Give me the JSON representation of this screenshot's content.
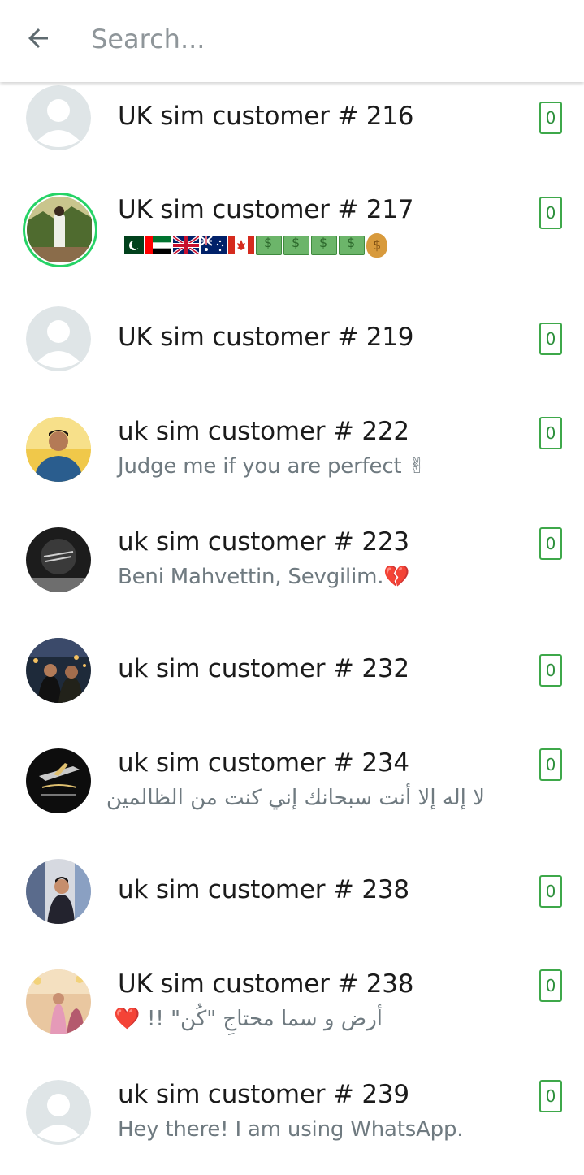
{
  "search": {
    "placeholder": "Search..."
  },
  "contacts": [
    {
      "name": "UK sim customer # 216",
      "about": "",
      "badge": "0",
      "avatar": "default"
    },
    {
      "name": "UK sim customer # 217",
      "about": "",
      "badge": "0",
      "avatar": "photo-outdoor",
      "about_icons": [
        "pakistan-flag-icon",
        "uae-flag-icon",
        "uk-flag-icon",
        "australia-flag-icon",
        "canada-flag-icon",
        "money-wings-icon",
        "dollar-bill-icon",
        "money-wings-icon",
        "money-wings-icon",
        "money-bag-icon"
      ]
    },
    {
      "name": "UK sim customer # 219",
      "about": "",
      "badge": "0",
      "avatar": "default"
    },
    {
      "name": "uk sim customer # 222",
      "about": "Judge me if you are perfect ✌",
      "badge": "0",
      "avatar": "photo-blue"
    },
    {
      "name": "uk sim customer # 223",
      "about": "Beni Mahvettin, Sevgilim.💔",
      "badge": "0",
      "avatar": "photo-dark"
    },
    {
      "name": "uk sim customer # 232",
      "about": "",
      "badge": "0",
      "avatar": "photo-night"
    },
    {
      "name": "uk sim customer # 234",
      "about": "لا إله إلا أنت سبحانك إني كنت من الظالمين",
      "badge": "0",
      "avatar": "photo-logo"
    },
    {
      "name": "uk sim customer # 238",
      "about": "",
      "badge": "0",
      "avatar": "photo-indoor"
    },
    {
      "name": "UK sim customer # 238",
      "about": "أرض و سما  محتاجِ \"کُن\" !! ❤️",
      "badge": "0",
      "avatar": "photo-pink"
    },
    {
      "name": "uk sim customer # 239",
      "about": "Hey there! I am using WhatsApp.",
      "badge": "0",
      "avatar": "default"
    }
  ],
  "colors": {
    "status_ring": "#25d366",
    "badge_border": "#3ea84a",
    "name_text": "#1b1b1b",
    "about_text": "#6f7a80",
    "placeholder": "#8f969a"
  }
}
